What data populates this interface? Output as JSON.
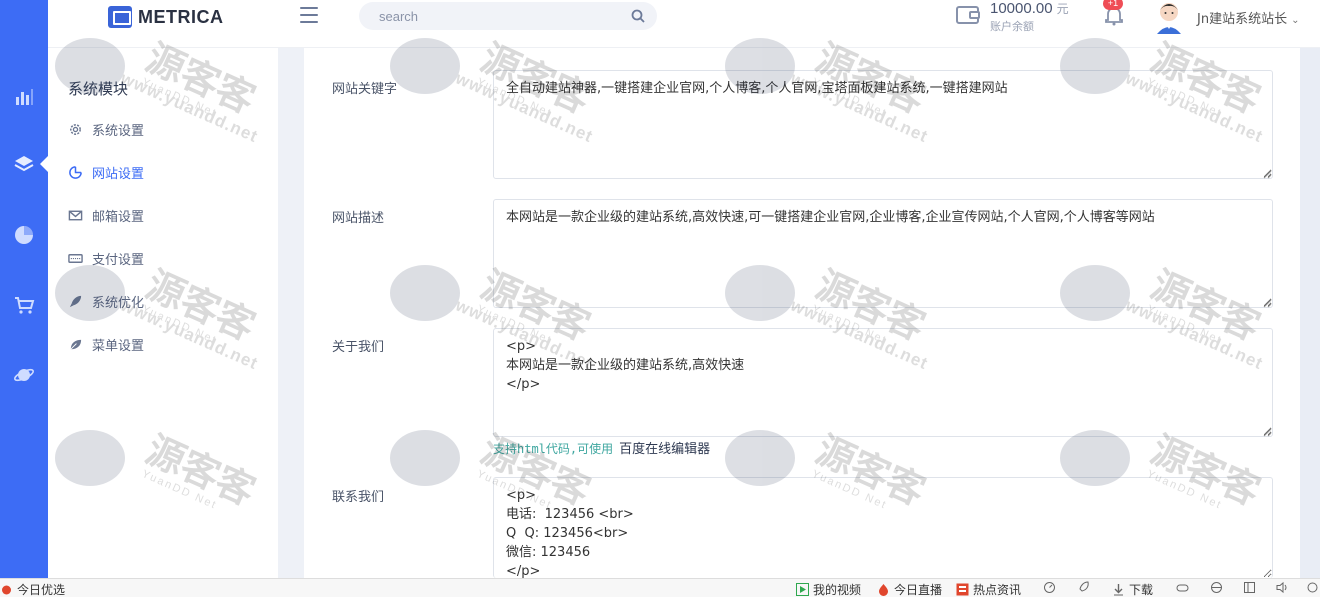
{
  "header": {
    "logo_text": "METRICA",
    "search_placeholder": "search",
    "balance_amount": "10000.00",
    "balance_unit": "元",
    "balance_label": "账户余额",
    "notification_badge": "+1",
    "user_name": "Jn建站系统站长",
    "user_caret": "⌄"
  },
  "rail": {
    "items": [
      "chart-icon",
      "layers-icon",
      "pie-icon",
      "cart-icon",
      "planet-icon"
    ],
    "active_index": 1,
    "color": "#3d6cf5"
  },
  "submenu": {
    "title": "系统模块",
    "items": [
      {
        "label": "系统设置",
        "icon": "gear-icon"
      },
      {
        "label": "网站设置",
        "icon": "globe-icon",
        "active": true
      },
      {
        "label": "邮箱设置",
        "icon": "mail-icon"
      },
      {
        "label": "支付设置",
        "icon": "card-icon"
      },
      {
        "label": "系统优化",
        "icon": "rocket-icon"
      },
      {
        "label": "菜单设置",
        "icon": "leaf-icon"
      }
    ]
  },
  "form": {
    "keywords_label": "网站关键字",
    "keywords_value": "全自动建站神器,一键搭建企业官网,个人博客,个人官网,宝塔面板建站系统,一键搭建网站",
    "description_label": "网站描述",
    "description_value": "本网站是一款企业级的建站系统,高效快速,可一键搭建企业官网,企业博客,企业宣传网站,个人官网,个人博客等网站",
    "about_label": "关于我们",
    "about_value": "<p>\n本网站是一款企业级的建站系统,高效快速\n</p>",
    "help_hint": "支持html代码,可使用",
    "help_link": "百度在线编辑器",
    "contact_label": "联系我们",
    "contact_value": "<p>\n电话:  123456 <br>\nQ  Q: 123456<br>\n微信: 123456\n</p>"
  },
  "watermark": {
    "big": "源客客",
    "sub": "YuanDD Net",
    "url": "www.yuandd.net"
  },
  "statusbar": {
    "left_label": "今日优选",
    "items": [
      "我的视频",
      "今日直播",
      "热点资讯",
      "下载"
    ]
  }
}
